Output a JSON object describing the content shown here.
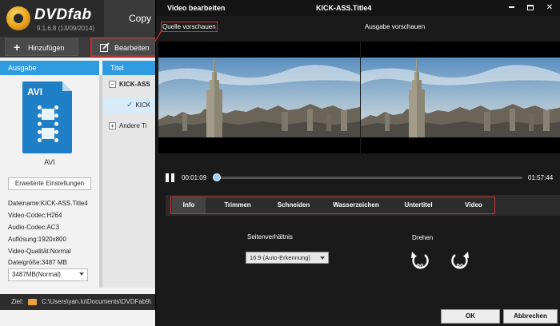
{
  "app": {
    "logo_text": "DVDfab",
    "version": "9.1.6.8 (13/09/2014)",
    "copy_tab": "Copy",
    "toolbar": {
      "add_label": "Hinzufügen",
      "edit_label": "Bearbeiten"
    },
    "columns": {
      "output": "Ausgabe",
      "title": "Titel"
    },
    "output_panel": {
      "format_badge": "AVI",
      "format_caption": "AVI",
      "advanced_button": "Erweiterte Einstellungen",
      "info": [
        "Dateiname:KICK-ASS.Title4",
        "Video-Codec:H264",
        "Audio-Codec:AC3",
        "Auflösung:1920x800",
        "Video-Qualität:Normal",
        "Dateigröße:3487 MB"
      ],
      "size_select": "3487MB(Normal)"
    },
    "tree": [
      {
        "toggle": "−",
        "label": "KICK-ASS"
      },
      {
        "label": "KICK"
      },
      {
        "toggle": "+",
        "label": "Andere Ti"
      }
    ],
    "status": {
      "label": "Ziel:",
      "path": "C:\\Users\\yan.lu\\Documents\\DVDFab9\\"
    }
  },
  "dialog": {
    "title": "Video bearbeiten",
    "file_title": "KICK-ASS.Title4",
    "source_label": "Quelle vorschauen",
    "output_label": "Ausgabe vorschauen",
    "player": {
      "current_time": "00:01:09",
      "total_time": "01:57:44",
      "progress": 0.01
    },
    "tabs": [
      "Info",
      "Trimmen",
      "Schneiden",
      "Wasserzeichen",
      "Untertitel",
      "Video"
    ],
    "active_tab": "Info",
    "aspect_label": "Seitenverhältnis",
    "aspect_value": "16:9 (Auto-Erkennung)",
    "rotate_label": "Drehen",
    "rotate_left_value": "90",
    "rotate_right_value": "90",
    "ok_label": "OK",
    "cancel_label": "Abbrechen"
  },
  "colors": {
    "accent_blue": "#2f9be0",
    "highlight_red": "#d32b2b",
    "dialog_bg": "#1a1a1a"
  }
}
